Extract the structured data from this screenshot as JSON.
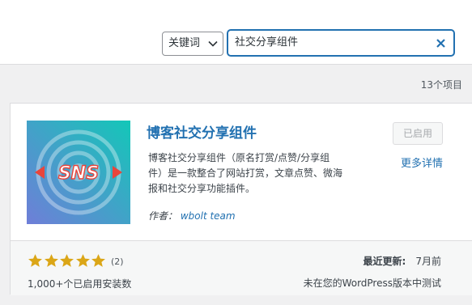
{
  "filter": {
    "selected": "关键词",
    "search_value": "社交分享组件"
  },
  "results": {
    "count_text": "13个项目"
  },
  "plugin": {
    "title": "博客社交分享组件",
    "icon_text": "SNS",
    "status_button": "已启用",
    "more_details": "更多详情",
    "description": "博客社交分享组件（原名打赏/点赞/分享组件）是一款整合了网站打赏，文章点赞、微海报和社交分享功能插件。",
    "author_label": "作者：",
    "author_name": "wbolt team",
    "rating": 5,
    "rating_count": "(2)",
    "installs": "1,000+个已启用安装数",
    "last_updated_label": "最近更新:",
    "last_updated_value": "7月前",
    "compatibility": "未在您的WordPress版本中测试"
  },
  "colors": {
    "accent": "#2271b1",
    "star": "#dba617",
    "icon_gradient_start": "#13c7b8",
    "icon_gradient_end": "#6f7ed8",
    "sns_red": "#e8453c"
  }
}
